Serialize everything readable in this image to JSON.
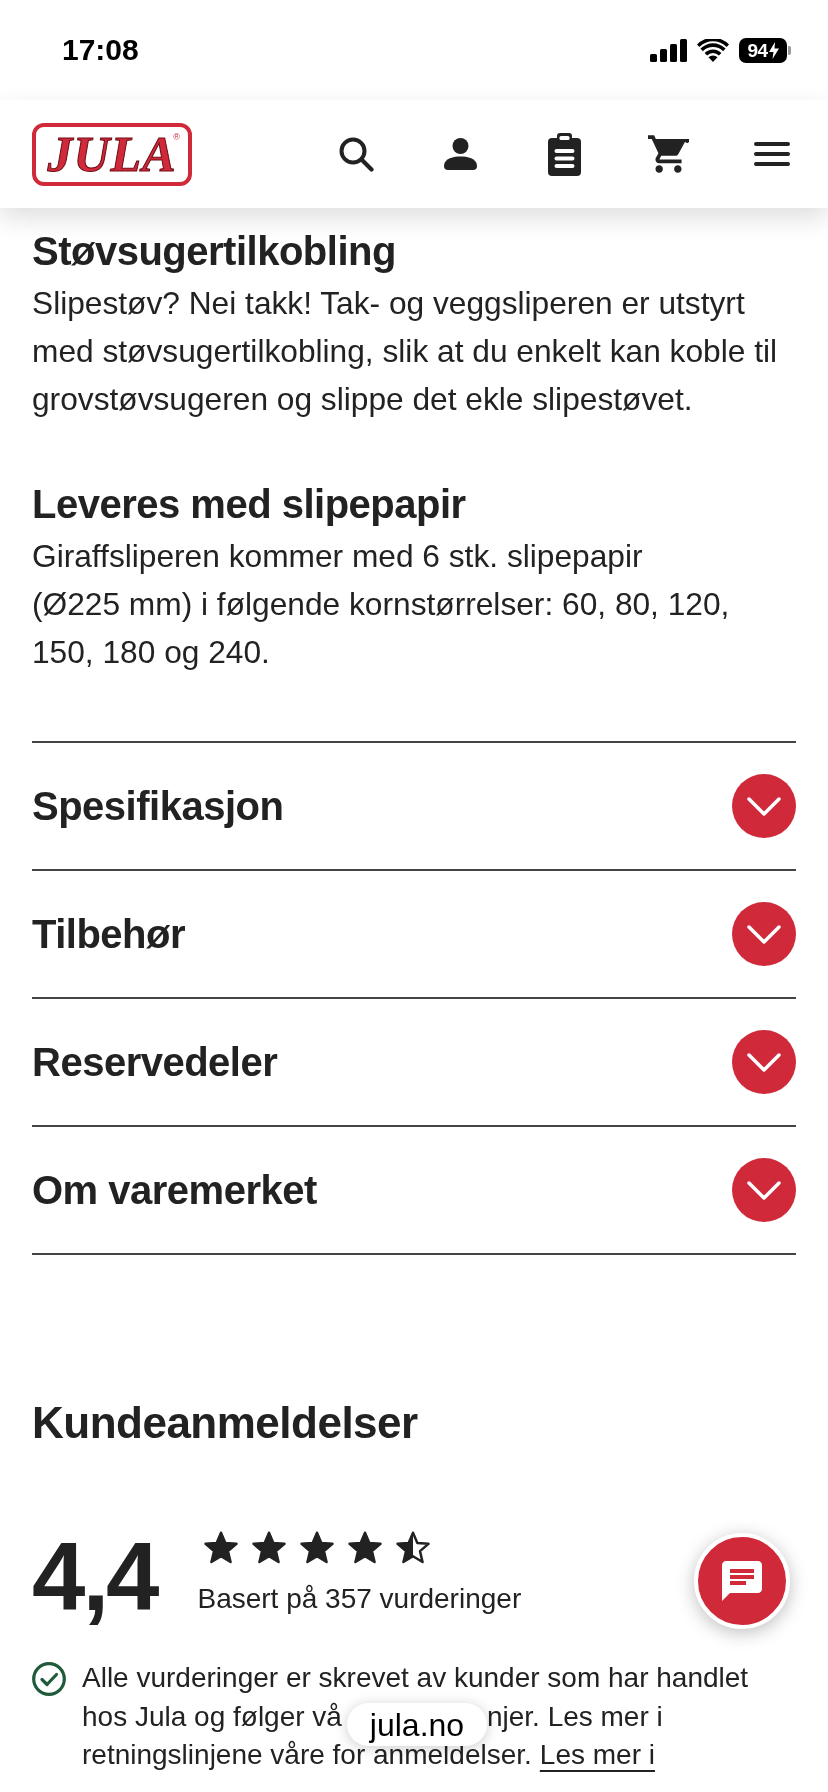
{
  "status_bar": {
    "time": "17:08",
    "battery": "94",
    "charging": true
  },
  "header": {
    "logo": {
      "text": "JULA",
      "mark": "®"
    }
  },
  "sections": [
    {
      "heading": "Støvsugertilkobling",
      "text": "Slipestøv? Nei takk! Tak- og veggsliperen er utstyrt med støvsugertilkobling, slik at du enkelt kan koble til grovstøvsugeren og slippe det ekle slipestøvet."
    },
    {
      "heading": "Leveres med slipepapir",
      "text": "Giraffsliperen kommer med 6 stk. slipepapir (Ø225 mm) i følgende kornstørrelser: 60, 80, 120, 150, 180 og 240."
    }
  ],
  "accordion": [
    {
      "title": "Spesifikasjon",
      "expanded": false
    },
    {
      "title": "Tilbehør",
      "expanded": false
    },
    {
      "title": "Reservedeler",
      "expanded": false
    },
    {
      "title": "Om varemerket",
      "expanded": false
    }
  ],
  "reviews": {
    "heading": "Kundeanmeldelser",
    "rating": "4,4",
    "stars": 4.5,
    "count_text": "Basert på 357 vurderinger",
    "notice": {
      "lines": [
        {
          "segments": [
            "Alle vurderinger er skrevet av kunder som har handlet"
          ]
        },
        {
          "segments": [
            "hos Jula og følger vå",
            "njer. Les mer i"
          ]
        },
        {
          "segments": [
            "retningslinjene våre for anmeldelser."
          ],
          "link": "Les mer i"
        }
      ]
    }
  },
  "browser_bar": {
    "url": "jula.no"
  }
}
